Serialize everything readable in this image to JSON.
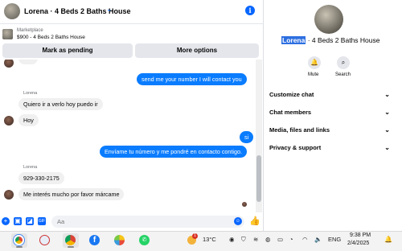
{
  "chat": {
    "title": "Lorena · 4 Beds 2 Baths House",
    "chevron_icon": "chevron-down-icon",
    "info_icon": "info-icon",
    "marketplace_label": "Marketplace",
    "listing_price_title": "$900 - 4 Beds 2 Baths House",
    "buttons": {
      "pending": "Mark as pending",
      "more": "More options"
    },
    "messages": [
      {
        "dir": "out",
        "text": "send me your number I will contact you"
      },
      {
        "dir": "in",
        "sender": "Lorena",
        "text": "Quiero ir a verlo hoy puedo ir"
      },
      {
        "dir": "in",
        "text": "Hoy"
      },
      {
        "dir": "out",
        "text": "si"
      },
      {
        "dir": "out",
        "text": "Envíame tu número y me pondré en contacto contigo."
      },
      {
        "dir": "in",
        "sender": "Lorena",
        "text": "929-330-2175"
      },
      {
        "dir": "in",
        "text": "Me interés mucho por favor márcame"
      }
    ],
    "composer_placeholder": "Aa"
  },
  "info": {
    "name_highlight": "Lorena",
    "title_rest": " · 4 Beds 2 Baths House",
    "mute_label": "Mute",
    "search_label": "Search",
    "menu": [
      "Customize chat",
      "Chat members",
      "Media, files and links",
      "Privacy & support"
    ]
  },
  "taskbar": {
    "temperature": "13°C",
    "language": "ENG",
    "time": "9:38 PM",
    "date": "2/4/2025",
    "notification_count": "1"
  },
  "colors": {
    "accent": "#0866ff",
    "outgoing_bubble": "#0a7cff",
    "incoming_bubble": "#f0f0f0"
  }
}
